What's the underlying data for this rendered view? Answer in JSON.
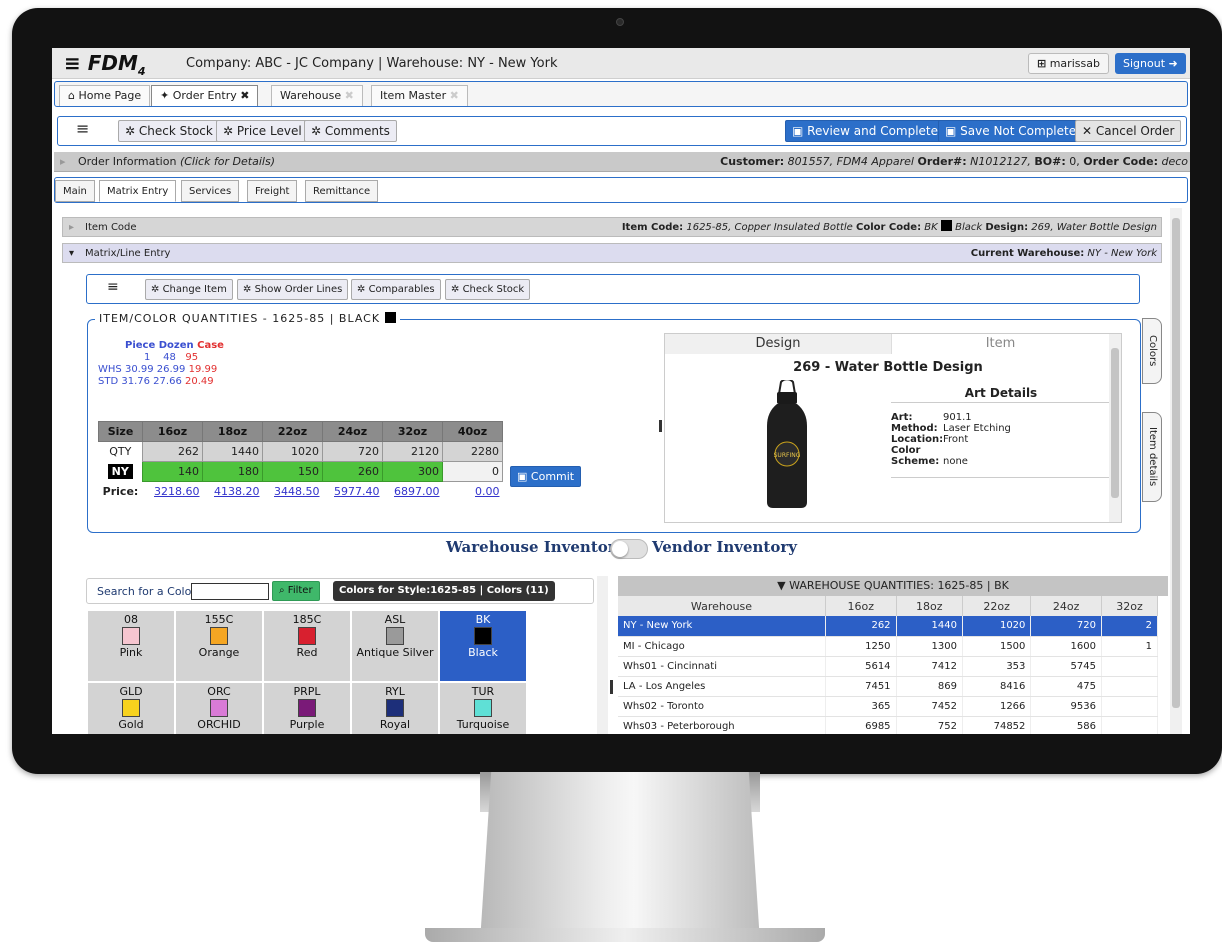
{
  "app": {
    "logo": "FDM",
    "logo_sub": "4",
    "company_info": "Company: ABC - JC Company  |  Warehouse: NY - New York",
    "user": "marissab",
    "signout": "Signout"
  },
  "tabs": [
    {
      "label": "Home Page"
    },
    {
      "label": "Order Entry",
      "close": "✖"
    },
    {
      "label": "Warehouse",
      "close": "✖"
    },
    {
      "label": "Item Master",
      "close": "✖"
    }
  ],
  "toolbar": {
    "menu": "≡",
    "check_stock": "Check Stock",
    "price_level": "Price Level",
    "comments": "Comments",
    "review": "Review and Complete",
    "save_not_complete": "Save Not Complete",
    "cancel": "Cancel Order"
  },
  "order_info": {
    "label": "Order Information",
    "hint": "(Click for Details)",
    "customer_key": "Customer:",
    "customer_val": "801557, FDM4 Apparel",
    "order_key": "Order#:",
    "order_val": "N1012127,",
    "bo_key": "BO#:",
    "bo_val": "0,",
    "code_key": "Order Code:",
    "code_val": "deco"
  },
  "subtabs": [
    "Main",
    "Matrix Entry",
    "Services",
    "Freight",
    "Remittance"
  ],
  "item_code_bar": {
    "label": "Item Code",
    "item_key": "Item Code:",
    "item_val": "1625-85, Copper Insulated Bottle",
    "color_key": "Color Code:",
    "color_val": "BK",
    "color_name": "Black",
    "design_key": "Design:",
    "design_val": "269, Water Bottle Design"
  },
  "matrix_bar": {
    "label": "Matrix/Line Entry",
    "wh_key": "Current Warehouse:",
    "wh_val": "NY - New York"
  },
  "inner_toolbar": {
    "menu": "≡",
    "change_item": "Change Item",
    "show_lines": "Show Order Lines",
    "comparables": "Comparables",
    "check_stock": "Check Stock"
  },
  "matrix": {
    "legend": "ITEM/COLOR QUANTITIES - 1625-85 | BLACK",
    "uom": {
      "piece": "Piece",
      "dozen": "Dozen",
      "case": "Case"
    },
    "uom_qty": {
      "piece": "1",
      "dozen": "48",
      "case": "95"
    },
    "whs_label": "WHS",
    "whs": {
      "piece": "30.99",
      "dozen": "26.99",
      "case": "19.99"
    },
    "std_label": "STD",
    "std": {
      "piece": "31.76",
      "dozen": "27.66",
      "case": "20.49"
    },
    "size_label": "Size",
    "qty_label": "QTY",
    "ny_label": "NY",
    "price_label": "Price:",
    "sizes": [
      "16oz",
      "18oz",
      "22oz",
      "24oz",
      "32oz",
      "40oz"
    ],
    "qty": [
      "262",
      "1440",
      "1020",
      "720",
      "2120",
      "2280"
    ],
    "ny": [
      "140",
      "180",
      "150",
      "260",
      "300",
      "0"
    ],
    "price": [
      "3218.60",
      "4138.20",
      "3448.50",
      "5977.40",
      "6897.00",
      "0.00"
    ],
    "commit": "Commit"
  },
  "design": {
    "tab_design": "Design",
    "tab_item": "Item",
    "title": "269 - Water Bottle Design",
    "art_details": "Art Details",
    "art_key": "Art:",
    "art_val": "901.1",
    "method_key": "Method:",
    "method_val": "Laser Etching",
    "location_key": "Location:",
    "location_val": "Front",
    "color_key": "Color",
    "scheme_key": "Scheme:",
    "scheme_val": "none",
    "bottle_text": "SURFING"
  },
  "side_tabs": {
    "colors": "Colors",
    "item_details": "Item details"
  },
  "inventory_toggle": {
    "left": "Warehouse Inventory",
    "right": "Vendor Inventory"
  },
  "color_search": {
    "label": "Search for a Color:",
    "value": "",
    "filter": "Filter",
    "badge": "Colors for Style:1625-85  |  Colors (11)"
  },
  "colors": [
    {
      "code": "08",
      "name": "Pink",
      "hex": "#f6c6d0"
    },
    {
      "code": "155C",
      "name": "Orange",
      "hex": "#f5a623"
    },
    {
      "code": "185C",
      "name": "Red",
      "hex": "#d8202f"
    },
    {
      "code": "ASL",
      "name": "Antique Silver",
      "hex": "#9a9a9a"
    },
    {
      "code": "BK",
      "name": "Black",
      "hex": "#000000"
    },
    {
      "code": "GLD",
      "name": "Gold",
      "hex": "#f7d21e"
    },
    {
      "code": "ORC",
      "name": "ORCHID",
      "hex": "#d97bd6"
    },
    {
      "code": "PRPL",
      "name": "Purple",
      "hex": "#7a1a78"
    },
    {
      "code": "RYL",
      "name": "Royal",
      "hex": "#1d2f7a"
    },
    {
      "code": "TUR",
      "name": "Turquoise",
      "hex": "#5fe0d6"
    }
  ],
  "warehouse_qty": {
    "title": "WAREHOUSE QUANTITIES: 1625-85 | BK",
    "headers": [
      "Warehouse",
      "16oz",
      "18oz",
      "22oz",
      "24oz",
      "32oz"
    ],
    "rows": [
      [
        "NY - New York",
        "262",
        "1440",
        "1020",
        "720",
        "2"
      ],
      [
        "MI - Chicago",
        "1250",
        "1300",
        "1500",
        "1600",
        "1"
      ],
      [
        "Whs01 - Cincinnati",
        "5614",
        "7412",
        "353",
        "5745",
        ""
      ],
      [
        "LA - Los Angeles",
        "7451",
        "869",
        "8416",
        "475",
        ""
      ],
      [
        "Whs02 - Toronto",
        "365",
        "7452",
        "1266",
        "9536",
        ""
      ],
      [
        "Whs03 - Peterborough",
        "6985",
        "752",
        "74852",
        "586",
        ""
      ]
    ]
  }
}
